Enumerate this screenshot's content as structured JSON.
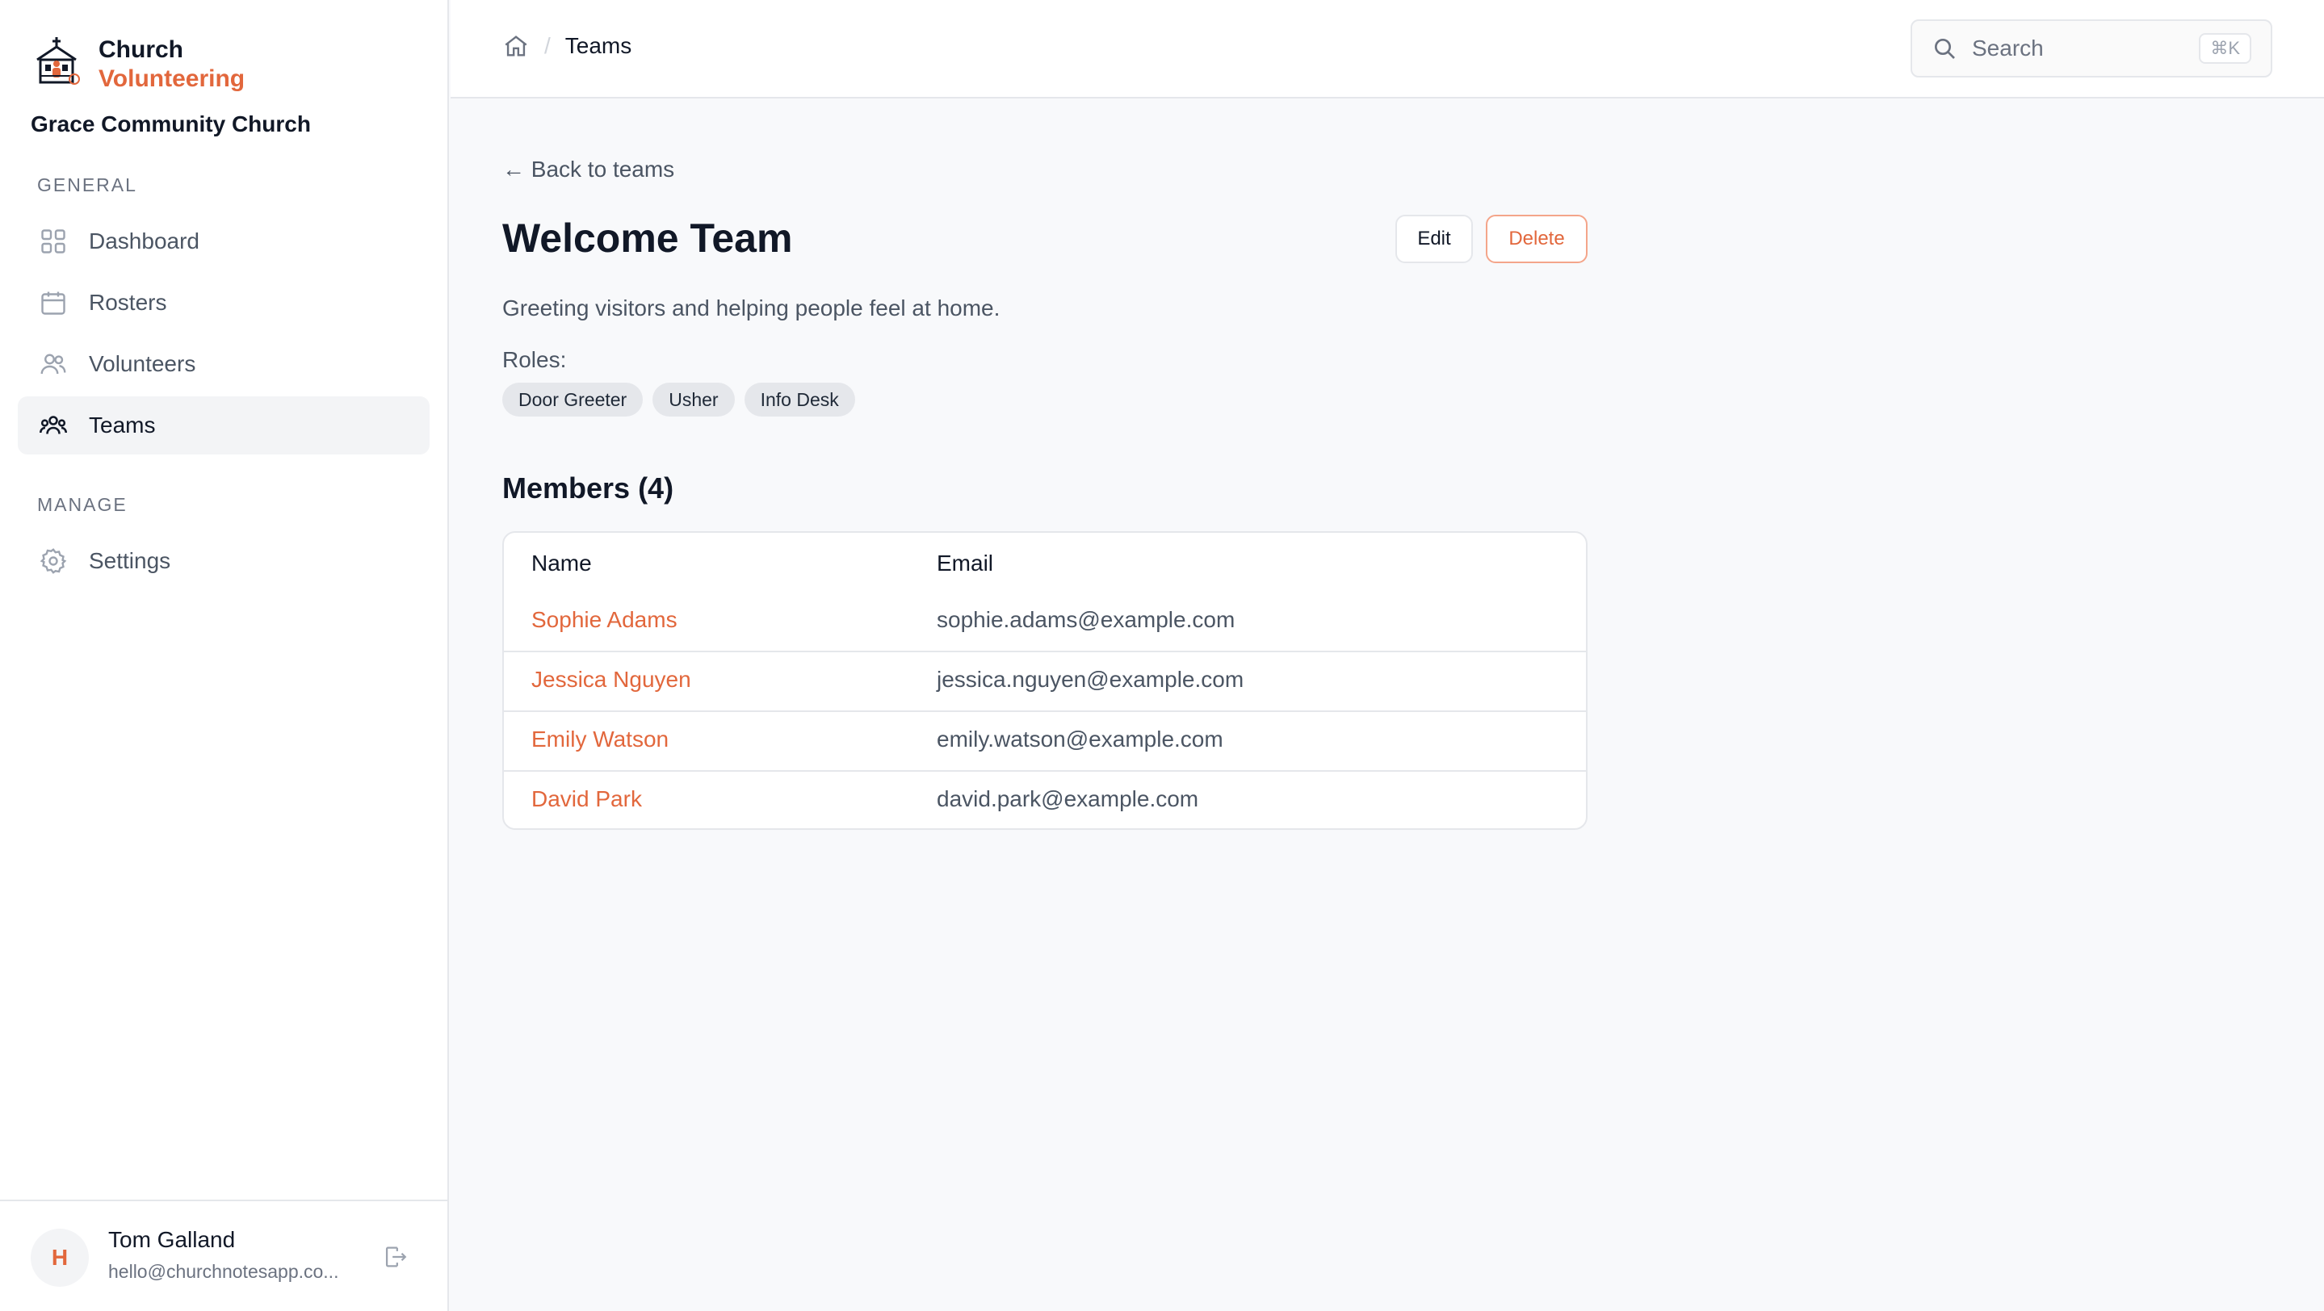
{
  "brand": {
    "line1": "Church",
    "line2": "Volunteering"
  },
  "org": {
    "name": "Grace Community Church"
  },
  "sidebar": {
    "general_label": "General",
    "manage_label": "Manage",
    "items": [
      {
        "label": "Dashboard",
        "icon": "grid-icon"
      },
      {
        "label": "Rosters",
        "icon": "calendar-icon"
      },
      {
        "label": "Volunteers",
        "icon": "users-icon"
      },
      {
        "label": "Teams",
        "icon": "team-icon",
        "active": true
      },
      {
        "label": "Settings",
        "icon": "gear-icon"
      }
    ]
  },
  "user": {
    "initial": "H",
    "name": "Tom Galland",
    "email": "hello@churchnotesapp.co..."
  },
  "topbar": {
    "breadcrumb_current": "Teams",
    "breadcrumb_separator": "/",
    "search_placeholder": "Search",
    "search_shortcut": "⌘K"
  },
  "team": {
    "back_label": "← Back to teams",
    "title": "Welcome Team",
    "edit_label": "Edit",
    "delete_label": "Delete",
    "description": "Greeting visitors and helping people feel at home.",
    "roles_label": "Roles:",
    "roles": [
      "Door Greeter",
      "Usher",
      "Info Desk"
    ]
  },
  "members": {
    "title": "Members (4)",
    "columns": [
      "Name",
      "Email"
    ],
    "rows": [
      {
        "name": "Sophie Adams",
        "email": "sophie.adams@example.com"
      },
      {
        "name": "Jessica Nguyen",
        "email": "jessica.nguyen@example.com"
      },
      {
        "name": "Emily Watson",
        "email": "emily.watson@example.com"
      },
      {
        "name": "David Park",
        "email": "david.park@example.com"
      }
    ]
  },
  "colors": {
    "accent": "#e2673c",
    "text": "#111827",
    "muted": "#4b5563",
    "border": "#e5e7eb"
  }
}
